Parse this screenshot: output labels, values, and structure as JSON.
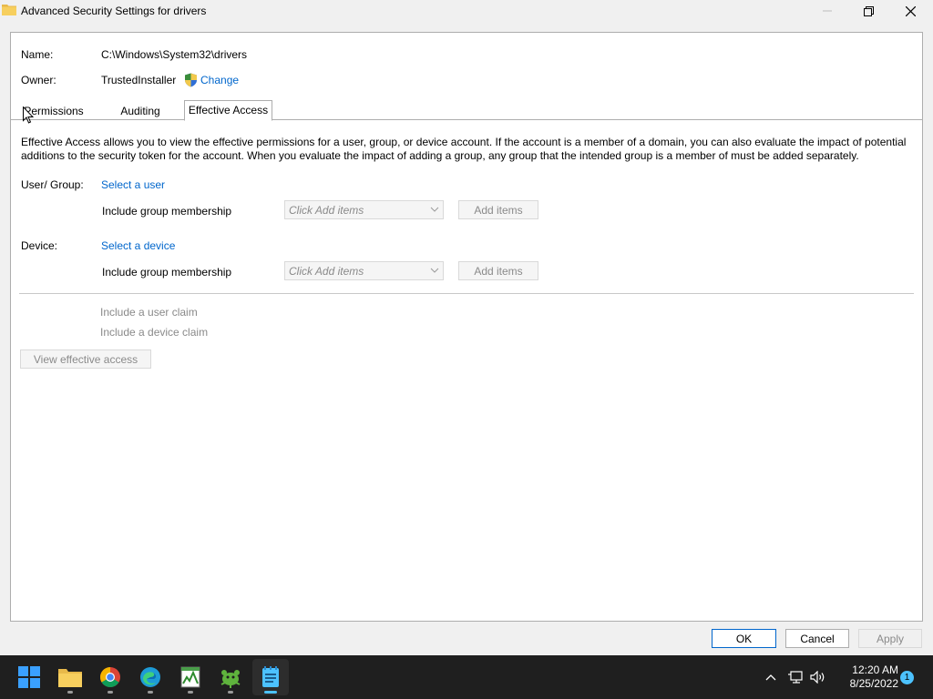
{
  "window": {
    "title": "Advanced Security Settings for drivers",
    "icon": "folder-icon"
  },
  "info": {
    "name_label": "Name:",
    "name_value": "C:\\Windows\\System32\\drivers",
    "owner_label": "Owner:",
    "owner_value": "TrustedInstaller",
    "change_link": "Change"
  },
  "tabs": [
    {
      "label": "Permissions",
      "active": false
    },
    {
      "label": "Auditing",
      "active": false
    },
    {
      "label": "Effective Access",
      "active": true
    }
  ],
  "description": "Effective Access allows you to view the effective permissions for a user, group, or device account. If the account is a member of a domain, you can also evaluate the impact of potential additions to the security token for the account. When you evaluate the impact of adding a group, any group that the intended group is a member of must be added separately.",
  "user_group": {
    "label": "User/ Group:",
    "select_link": "Select a user",
    "membership_label": "Include group membership",
    "dropdown_value": "Click Add items",
    "add_button": "Add items"
  },
  "device": {
    "label": "Device:",
    "select_link": "Select a device",
    "membership_label": "Include group membership",
    "dropdown_value": "Click Add items",
    "add_button": "Add items"
  },
  "claims": {
    "user_claim": "Include a user claim",
    "device_claim": "Include a device claim"
  },
  "view_button": "View effective access",
  "buttons": {
    "ok": "OK",
    "cancel": "Cancel",
    "apply": "Apply"
  },
  "taskbar": {
    "apps": [
      "windows-start-icon",
      "file-explorer-icon",
      "chrome-icon",
      "edge-icon",
      "task-manager-icon",
      "greenshot-icon",
      "notepad-icon"
    ],
    "time": "12:20 AM",
    "date": "8/25/2022",
    "notifications": "1"
  },
  "colors": {
    "link": "#0066cc",
    "accent": "#4cc2ff",
    "taskbar": "#1f1f1f"
  }
}
